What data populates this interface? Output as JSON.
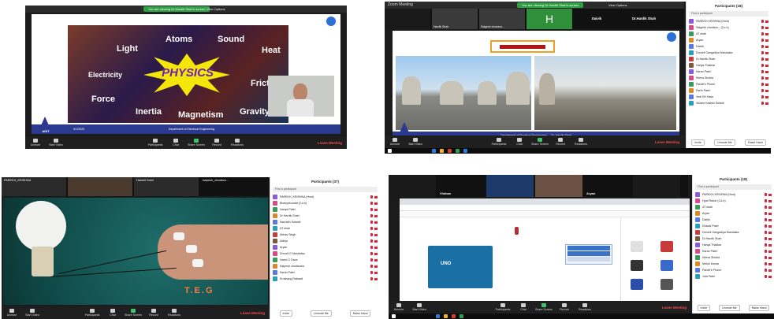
{
  "panel1": {
    "green_pill": "You are viewing Dr Hardik Shah's screen",
    "view_options": "View Options",
    "topics": [
      "Light",
      "Atoms",
      "Sound",
      "Heat",
      "Electricity",
      "PHYSICS",
      "Friction",
      "Force",
      "Inertia",
      "Magnetism",
      "Gravity"
    ],
    "footer_left": "6/1/2020",
    "footer_center": "Department of Electrical Engineering",
    "logo_text": "ADIT",
    "toolbar": [
      "Unmute",
      "Start Video",
      "Participants",
      "Chat",
      "Share Screen",
      "Record",
      "Reactions"
    ],
    "leave": "Leave Meeting"
  },
  "panel2": {
    "title": "Zoom Meeting",
    "green_pill": "You are viewing Dr Hardik Shah's screen",
    "view_options": "View Options",
    "thumbs": [
      "Hardik Shah",
      "Salgesh chodava...",
      "H",
      "Daivik",
      "Dr.Hardik Shah"
    ],
    "thumb_sub": "Hanya Thakkar",
    "footer_left": "6/1/2020",
    "footer_center": "Department of Electrical Engineering — Dr. Hardik Shah",
    "logo_text": "ADIT",
    "toolbar": [
      "Unmute",
      "Start Video",
      "Participants",
      "Chat",
      "Share Screen",
      "Record",
      "Reactions"
    ],
    "leave": "Leave Meeting",
    "participants_title": "Participants (18)",
    "find": "Find a participant",
    "participants": [
      "PAREKH KRISHNA (Host)",
      "Salgesh chodava... (Co-h)",
      "AT shah",
      "Aryan",
      "Daivik",
      "Dhruvit Gangadiya Mandalsa",
      "Dr.Hardik Shah",
      "Hanya Thakkar",
      "Karan Patel",
      "Kiteva Shukla",
      "Pandit's Phone",
      "Parth Patel",
      "Vedi SH Nata",
      "Vikram Kashiki Solank"
    ],
    "footer_buttons": [
      "Invite",
      "Unmute Me",
      "Raise Hand"
    ]
  },
  "panel3": {
    "thumbs": [
      "PAREKH_KRISHNA",
      "",
      "Harshil Gohil",
      "kalpesh_chodava..."
    ],
    "watermark": "T.E.G",
    "toolbar": [
      "Unmute",
      "Start Video",
      "Participants",
      "Chat",
      "Share Screen",
      "Record",
      "Reactions"
    ],
    "leave": "Leave Meeting",
    "participants_title": "Participants (37)",
    "find": "Find a participant",
    "participants": [
      "PAREKH_KRISHNA (Host)",
      "Bhavyasundar (Co-h)",
      "Hanya Patel",
      "Dr Hardik Shah",
      "Saurabh Solanki",
      "AT shah",
      "Abhay Singh",
      "Aditya",
      "Aryan",
      "Dhruvil G Mandalsa",
      "Harsh C Dave",
      "Kalpesh chodavara",
      "Karan Patel",
      "Krushang Dalwadi"
    ],
    "footer_buttons": [
      "Invite",
      "Unmute Me",
      "Raise Hand"
    ]
  },
  "panel4": {
    "title": "Zoom Meeting",
    "thumbs": [
      "",
      "Vishwa",
      "",
      "",
      "Aryan",
      ""
    ],
    "toolbar": [
      "Unmute",
      "Start Video",
      "Participants",
      "Chat",
      "Share Screen",
      "Record",
      "Reactions"
    ],
    "leave": "Leave Meeting",
    "arduino_label": "UNO",
    "participants_title": "Participants (18)",
    "find": "Find a participant",
    "participants": [
      "PAREKH KRISHNA (Host)",
      "Hpat Rahar (Co-h)",
      "AT shah",
      "Aryan",
      "Daivik",
      "Dhaval Patel",
      "Dhruvit Gangadiya Mandalsa",
      "Dr.Hardik Shah",
      "Hanya Thakkar",
      "Karan Patel",
      "Kiteva Shukla",
      "Mehul Kumar",
      "Pandit's Phone",
      "Jula Patel"
    ],
    "footer_buttons": [
      "Invite",
      "Unmute Me",
      "Raise Hand"
    ]
  },
  "colors": {
    "zoom_dark": "#1f1f1f",
    "leave_red": "#ff4a4a",
    "zoom_green": "#2ea043",
    "slide_blue": "#2b3a8f"
  }
}
